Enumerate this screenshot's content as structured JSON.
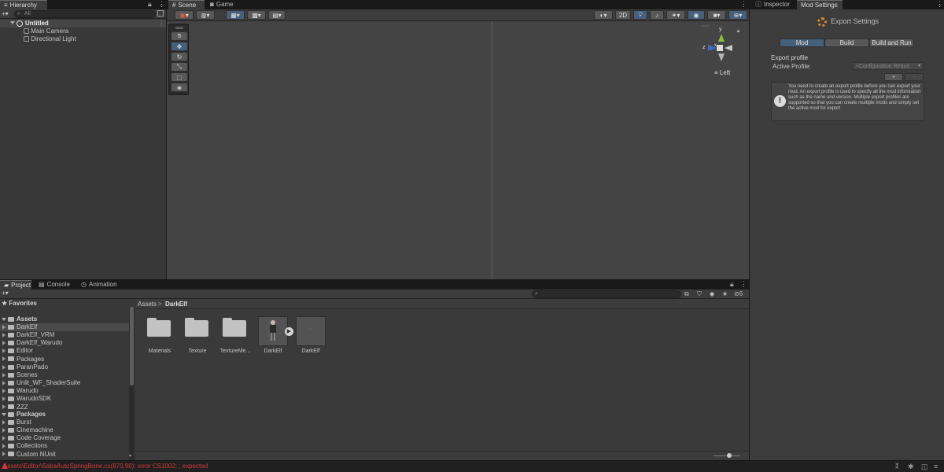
{
  "hierarchy": {
    "tab_label": "Hierarchy",
    "search_placeholder": "All",
    "scene_name": "Untitled",
    "items": [
      {
        "label": "Main Camera"
      },
      {
        "label": "Directional Light"
      }
    ]
  },
  "scene_view": {
    "tabs": [
      {
        "label": "Scene"
      },
      {
        "label": "Game"
      }
    ],
    "mode_2d": "2D",
    "gizmo_axes": {
      "y": "y",
      "x": "x",
      "z": "z"
    },
    "gizmo_view": "Left"
  },
  "inspector": {
    "tabs": [
      {
        "label": "Inspector"
      },
      {
        "label": "Mod Settings"
      }
    ],
    "title": "Export Settings",
    "mode_tabs": [
      {
        "label": "Mod"
      },
      {
        "label": "Build"
      },
      {
        "label": "Build and Run"
      }
    ],
    "section_title": "Export profile",
    "active_profile_label": "Active Profile:",
    "active_profile_value": "<Configuration Requir",
    "add_label": "+",
    "remove_label": "-",
    "help_text": "You need to create an export profile before you can export your mod. An export profile is used to specify all the mod information such as the name and version. Multiple export profiles are supported so that you can create multiple mods and simply set the active mod for export"
  },
  "project": {
    "tabs": [
      {
        "label": "Project"
      },
      {
        "label": "Console"
      },
      {
        "label": "Animation"
      }
    ],
    "breadcrumb": {
      "root": "Assets",
      "sep": ">",
      "current": "DarkElf"
    },
    "hidden_count": "6",
    "favorites_label": "Favorites",
    "assets_label": "Assets",
    "asset_folders": [
      "DarkElf",
      "DarkElf_VRM",
      "DarkElf_Warudo",
      "Editor",
      "Packages",
      "ParanPado",
      "Scenes",
      "Unlit_WF_ShaderSuite",
      "Warudo",
      "WarudoSDK",
      "ZZZ"
    ],
    "packages_label": "Packages",
    "package_folders": [
      "Burst",
      "Cinemachine",
      "Code Coverage",
      "Collections",
      "Custom NUnit"
    ],
    "grid_items": [
      {
        "label": "Materials"
      },
      {
        "label": "Texture"
      },
      {
        "label": "TextureMe..."
      },
      {
        "label": "DarkElf"
      },
      {
        "label": "DarkElf"
      }
    ]
  },
  "status": {
    "error_text": "Assets\\Editor\\SabaAutoSpringBone.cs(870,90): error CS1002: ; expected",
    "error_color": "#d03a3a"
  },
  "colors": {
    "accent": "#46607c",
    "selection": "#2c5d87"
  }
}
